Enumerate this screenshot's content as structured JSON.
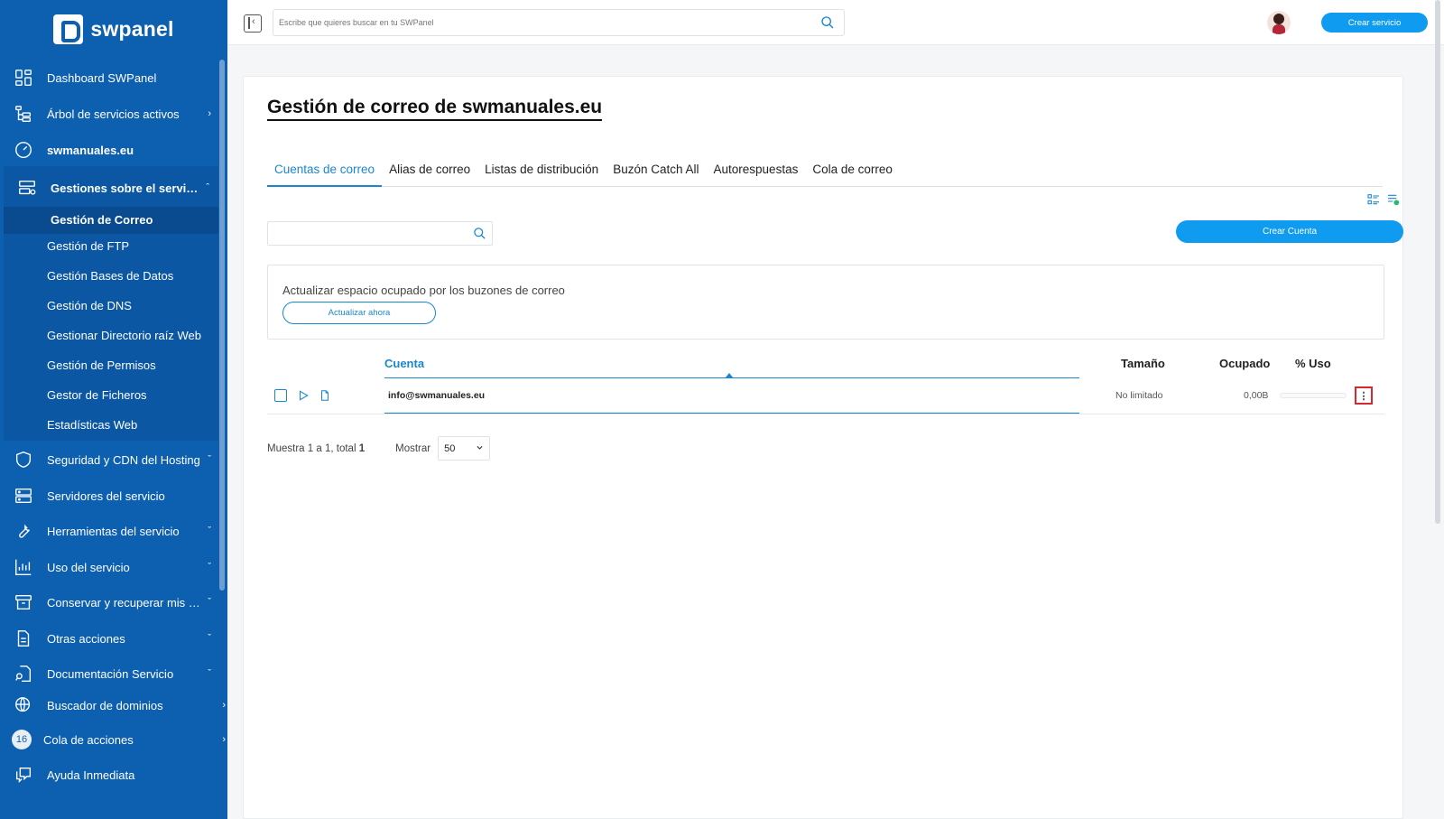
{
  "app": {
    "brand": "swpanel"
  },
  "sidebar": {
    "items": [
      {
        "label": "Dashboard SWPanel",
        "icon": "dashboard-icon"
      },
      {
        "label": "Árbol de servicios activos",
        "icon": "tree-icon",
        "chevron": "›"
      },
      {
        "label": "swmanuales.eu",
        "icon": "gauge-icon"
      },
      {
        "label": "Gestiones sobre el servicio",
        "icon": "server-gear-icon",
        "chevron": "ˆ"
      },
      {
        "label": "Seguridad y CDN del Hosting",
        "icon": "shield-icon",
        "chevron": "ˇ"
      },
      {
        "label": "Servidores del servicio",
        "icon": "servers-icon"
      },
      {
        "label": "Herramientas del servicio",
        "icon": "wrench-icon",
        "chevron": "ˇ"
      },
      {
        "label": "Uso del servicio",
        "icon": "chart-icon",
        "chevron": "ˇ"
      },
      {
        "label": "Conservar y recuperar mis dat…",
        "icon": "archive-icon",
        "chevron": "ˇ"
      },
      {
        "label": "Otras acciones",
        "icon": "document-icon",
        "chevron": "ˇ"
      },
      {
        "label": "Documentación Servicio",
        "icon": "doc-search-icon",
        "chevron": "ˇ"
      },
      {
        "label": "Buscador de dominios",
        "icon": "globe-icon",
        "chevron": "›"
      },
      {
        "label": "Cola de acciones",
        "badge": "16",
        "chevron": "›"
      },
      {
        "label": "Ayuda Inmediata",
        "icon": "chat-icon"
      }
    ],
    "subitems": [
      "Gestión de Correo",
      "Gestión de FTP",
      "Gestión Bases de Datos",
      "Gestión de DNS",
      "Gestionar Directorio raíz Web",
      "Gestión de Permisos",
      "Gestor de Ficheros",
      "Estadísticas Web"
    ]
  },
  "topbar": {
    "search_placeholder": "Escribe que quieres buscar en tu SWPanel",
    "create_service": "Crear servicio"
  },
  "main": {
    "title": "Gestión de correo de swmanuales.eu",
    "tabs": [
      "Cuentas de correo",
      "Alias de correo",
      "Listas de distribución",
      "Buzón Catch All",
      "Autorespuestas",
      "Cola de correo"
    ],
    "create_account": "Crear Cuenta",
    "update_text": "Actualizar espacio ocupado por los buzones de correo",
    "update_button": "Actualizar ahora",
    "table": {
      "headers": {
        "account": "Cuenta",
        "size": "Tamaño",
        "used": "Ocupado",
        "usage": "% Uso"
      },
      "rows": [
        {
          "email": "info@swmanuales.eu",
          "size": "No limitado",
          "used": "0,00B",
          "usage_pct": 0
        }
      ]
    },
    "pager": {
      "prefix": "Muestra",
      "from": "1",
      "sep": "a",
      "to": "1",
      "total_label": ", total",
      "total": "1",
      "show_label": "Mostrar",
      "page_size": "50"
    }
  },
  "colors": {
    "sidebar": "#0d5fb0",
    "accent": "#0f9bf0",
    "link": "#1a86d0",
    "highlight": "#d7282f"
  }
}
